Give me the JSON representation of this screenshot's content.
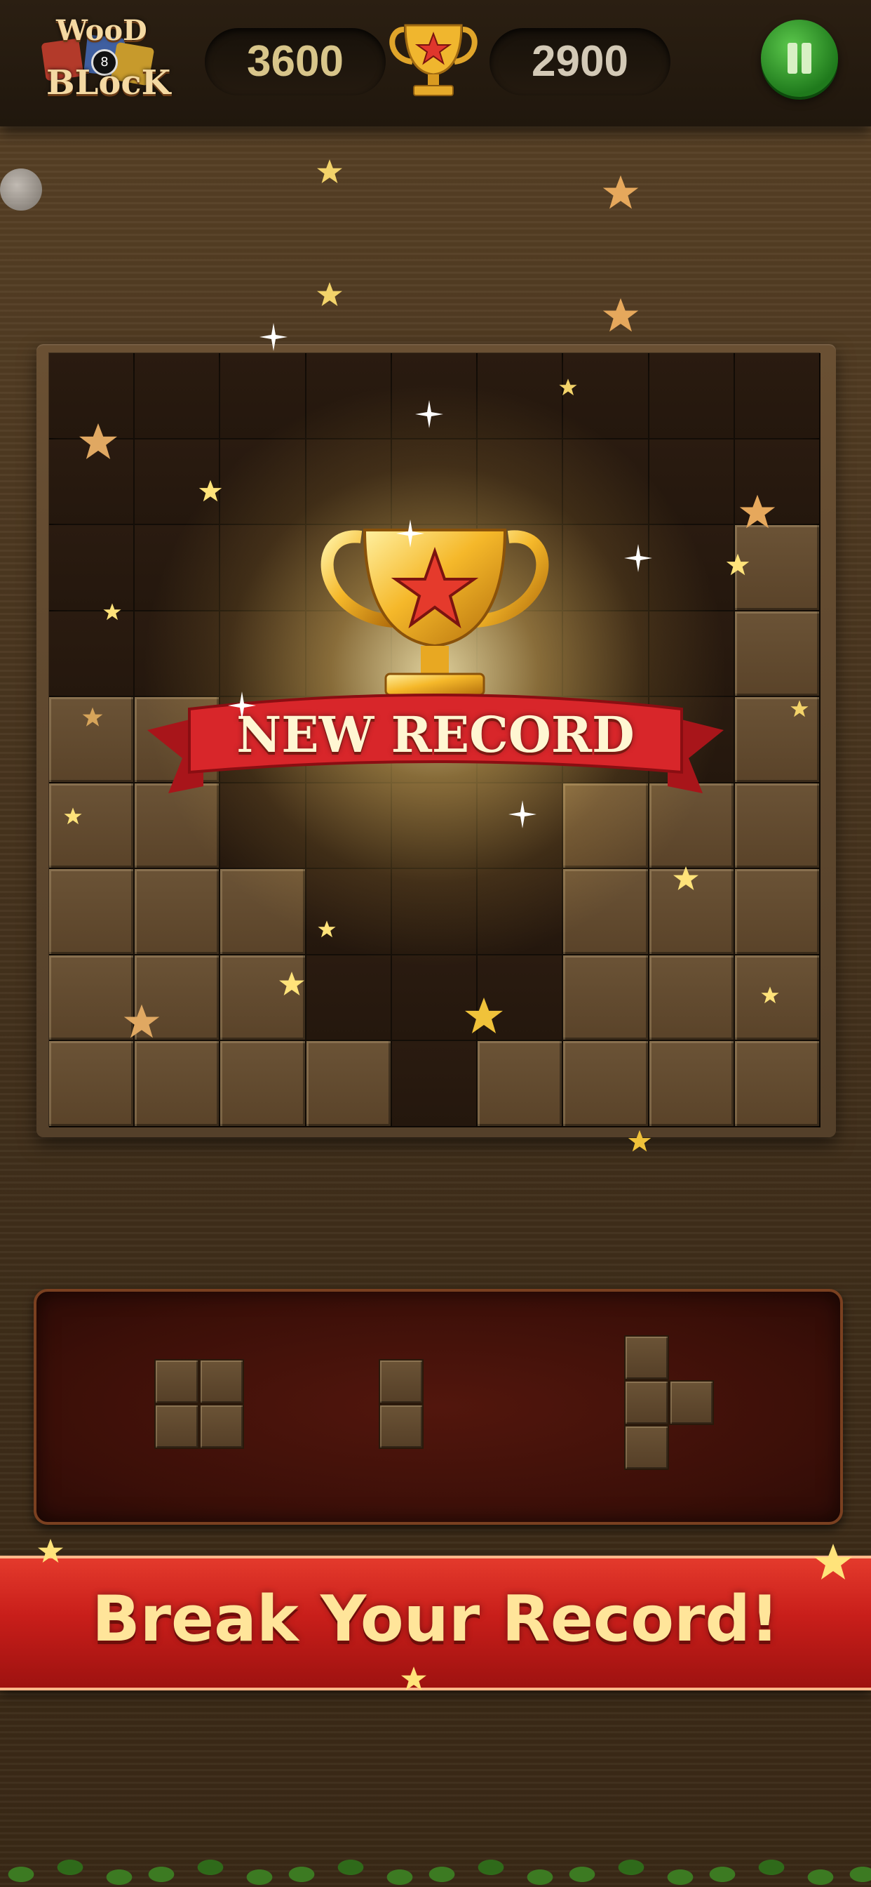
{
  "header": {
    "logo_line1": "WooD",
    "logo_line2": "BLocK",
    "logo_ball": "8",
    "current_score": "3600",
    "best_score": "2900"
  },
  "overlay": {
    "title": "NEW RECORD"
  },
  "board": {
    "rows": 9,
    "cols": 9,
    "filled": [
      [
        0,
        0,
        0,
        0,
        0,
        0,
        0,
        0,
        0
      ],
      [
        0,
        0,
        0,
        0,
        0,
        0,
        0,
        0,
        0
      ],
      [
        0,
        0,
        0,
        0,
        0,
        0,
        0,
        0,
        1
      ],
      [
        0,
        0,
        0,
        0,
        0,
        0,
        0,
        0,
        1
      ],
      [
        1,
        1,
        0,
        0,
        0,
        0,
        0,
        0,
        1
      ],
      [
        1,
        1,
        0,
        0,
        0,
        0,
        1,
        1,
        1
      ],
      [
        1,
        1,
        1,
        0,
        0,
        0,
        1,
        1,
        1
      ],
      [
        1,
        1,
        1,
        0,
        0,
        0,
        1,
        1,
        1
      ],
      [
        1,
        1,
        1,
        1,
        0,
        1,
        1,
        1,
        1
      ]
    ]
  },
  "pieces": [
    {
      "name": "square-2x2",
      "cells": [
        [
          0,
          0
        ],
        [
          0,
          1
        ],
        [
          1,
          0
        ],
        [
          1,
          1
        ]
      ]
    },
    {
      "name": "vertical-2",
      "cells": [
        [
          0,
          0
        ],
        [
          1,
          0
        ]
      ]
    },
    {
      "name": "t-piece",
      "cells": [
        [
          0,
          0
        ],
        [
          1,
          0
        ],
        [
          1,
          1
        ],
        [
          2,
          0
        ]
      ]
    }
  ],
  "promo": {
    "text": "Break Your Record!"
  },
  "colors": {
    "wood_block": "#6b5336",
    "board_empty": "#24170d",
    "ribbon_red": "#c81e1a",
    "gold_text": "#ffe59a",
    "pause_green": "#2e9a28"
  }
}
